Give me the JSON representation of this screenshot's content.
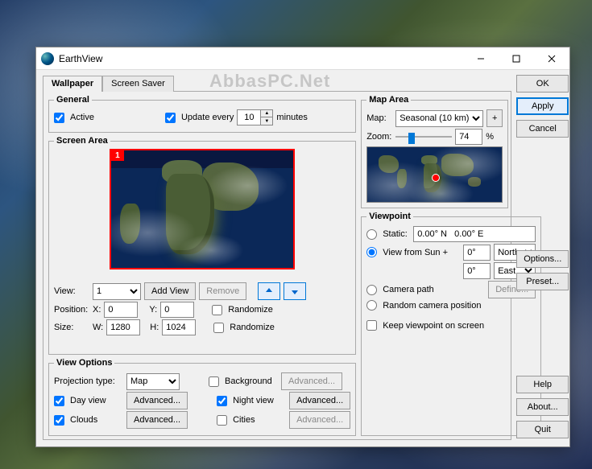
{
  "window": {
    "title": "EarthView"
  },
  "watermark": "AbbasPC.Net",
  "tabs": [
    {
      "label": "Wallpaper",
      "active": true
    },
    {
      "label": "Screen Saver",
      "active": false
    }
  ],
  "general": {
    "legend": "General",
    "active_label": "Active",
    "active_checked": true,
    "update_label": "Update every",
    "update_checked": true,
    "update_value": "10",
    "update_unit": "minutes"
  },
  "screen_area": {
    "legend": "Screen Area",
    "badge": "1",
    "view_label": "View:",
    "view_value": "1",
    "add_view": "Add View",
    "remove": "Remove",
    "position_label": "Position:",
    "x_label": "X:",
    "x_value": "0",
    "y_label": "Y:",
    "y_value": "0",
    "randomize_pos": "Randomize",
    "size_label": "Size:",
    "w_label": "W:",
    "w_value": "1280",
    "h_label": "H:",
    "h_value": "1024",
    "randomize_size": "Randomize"
  },
  "view_options": {
    "legend": "View Options",
    "projection_label": "Projection type:",
    "projection_value": "Map",
    "background_label": "Background",
    "day_view_label": "Day view",
    "day_view_checked": true,
    "night_view_label": "Night view",
    "night_view_checked": true,
    "clouds_label": "Clouds",
    "clouds_checked": true,
    "cities_label": "Cities",
    "advanced": "Advanced..."
  },
  "map_area": {
    "legend": "Map Area",
    "map_label": "Map:",
    "map_value": "Seasonal (10 km)",
    "plus": "+",
    "zoom_label": "Zoom:",
    "zoom_value": "74",
    "zoom_unit": "%"
  },
  "viewpoint": {
    "legend": "Viewpoint",
    "static_label": "Static:",
    "static_value": "0.00° N   0.00° E",
    "sun_label": "View from Sun +",
    "sun_deg1": "0°",
    "sun_dir1": "North",
    "sun_deg2": "0°",
    "sun_dir2": "East",
    "camera_label": "Camera path",
    "define": "Define...",
    "random_label": "Random camera position",
    "keep_label": "Keep viewpoint on screen"
  },
  "buttons": {
    "ok": "OK",
    "apply": "Apply",
    "cancel": "Cancel",
    "options": "Options...",
    "preset": "Preset...",
    "help": "Help",
    "about": "About...",
    "quit": "Quit"
  }
}
